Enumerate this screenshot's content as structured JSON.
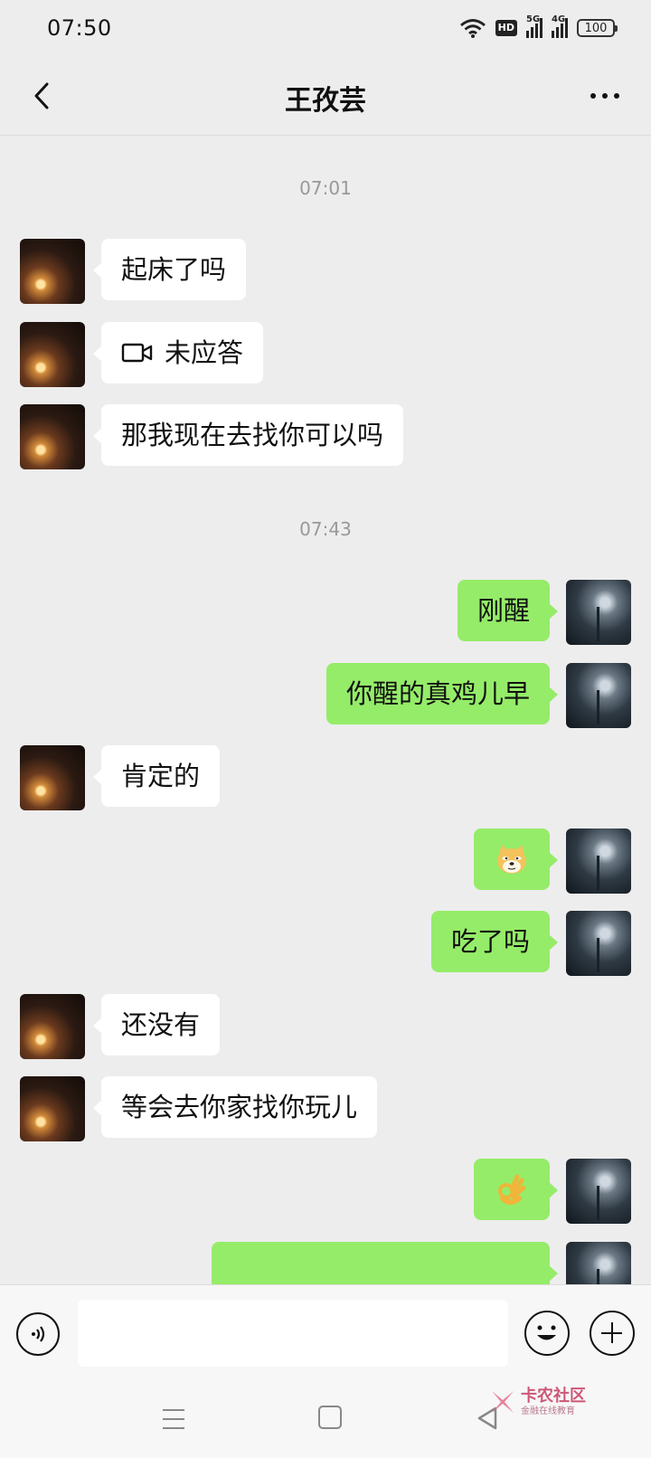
{
  "status_bar": {
    "time": "07:50",
    "hd_label": "HD",
    "network_1": "5G",
    "network_2": "4G",
    "battery": "100"
  },
  "header": {
    "title": "王孜芸",
    "back_icon": "chevron-left-icon",
    "more_icon": "more-dots-icon"
  },
  "chat": {
    "timestamps": [
      "07:01",
      "07:43"
    ],
    "messages": [
      {
        "from": "contact",
        "text": "起床了吗"
      },
      {
        "from": "contact",
        "type": "video-call",
        "text": "未应答",
        "icon": "video-camera-icon"
      },
      {
        "from": "contact",
        "text": "那我现在去找你可以吗"
      },
      {
        "from": "me",
        "text": "刚醒"
      },
      {
        "from": "me",
        "text": "你醒的真鸡儿早"
      },
      {
        "from": "contact",
        "text": "肯定的"
      },
      {
        "from": "me",
        "type": "emoji",
        "icon": "doge-emoji-icon"
      },
      {
        "from": "me",
        "text": "吃了吗"
      },
      {
        "from": "contact",
        "text": "还没有"
      },
      {
        "from": "contact",
        "text": "等会去你家找你玩儿"
      },
      {
        "from": "me",
        "type": "emoji",
        "icon": "ok-hand-emoji-icon"
      }
    ]
  },
  "input_bar": {
    "voice_icon": "voice-icon",
    "input_value": "",
    "emoji_icon": "smiley-icon",
    "plus_icon": "plus-icon"
  },
  "nav_bar": {
    "menu_icon": "menu-icon",
    "home_icon": "home-icon",
    "back_icon": "back-triangle-icon"
  },
  "watermark": {
    "title": "卡农社区",
    "subtitle": "金融在线教育"
  },
  "colors": {
    "outgoing_bubble": "#95ec69",
    "incoming_bubble": "#ffffff",
    "background": "#ededed"
  }
}
